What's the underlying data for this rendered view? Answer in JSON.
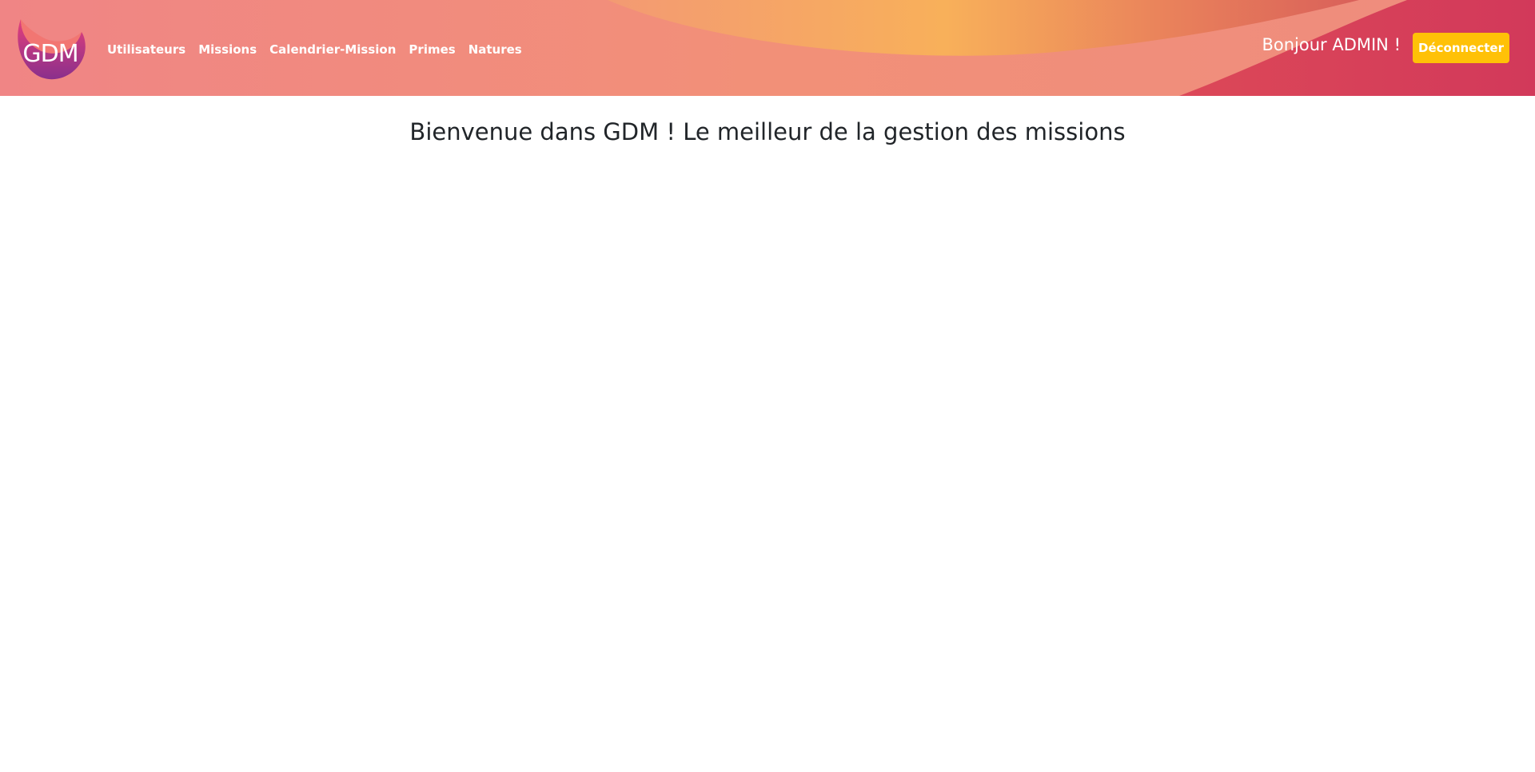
{
  "app": {
    "logo_text": "GDM"
  },
  "nav": {
    "items": [
      {
        "label": "Utilisateurs"
      },
      {
        "label": "Missions"
      },
      {
        "label": "Calendrier-Mission"
      },
      {
        "label": "Primes"
      },
      {
        "label": "Natures"
      }
    ]
  },
  "user": {
    "greeting": "Bonjour ADMIN !",
    "logout_label": "Déconnecter"
  },
  "main": {
    "welcome_text": "Bienvenue dans GDM ! Le meilleur de la gestion des missions"
  },
  "colors": {
    "header_primary": "#f18a84",
    "header_accent_orange": "#f8ae5a",
    "header_accent_red": "#d63b5a",
    "logout_button": "#ffc107",
    "text_dark": "#212529"
  }
}
